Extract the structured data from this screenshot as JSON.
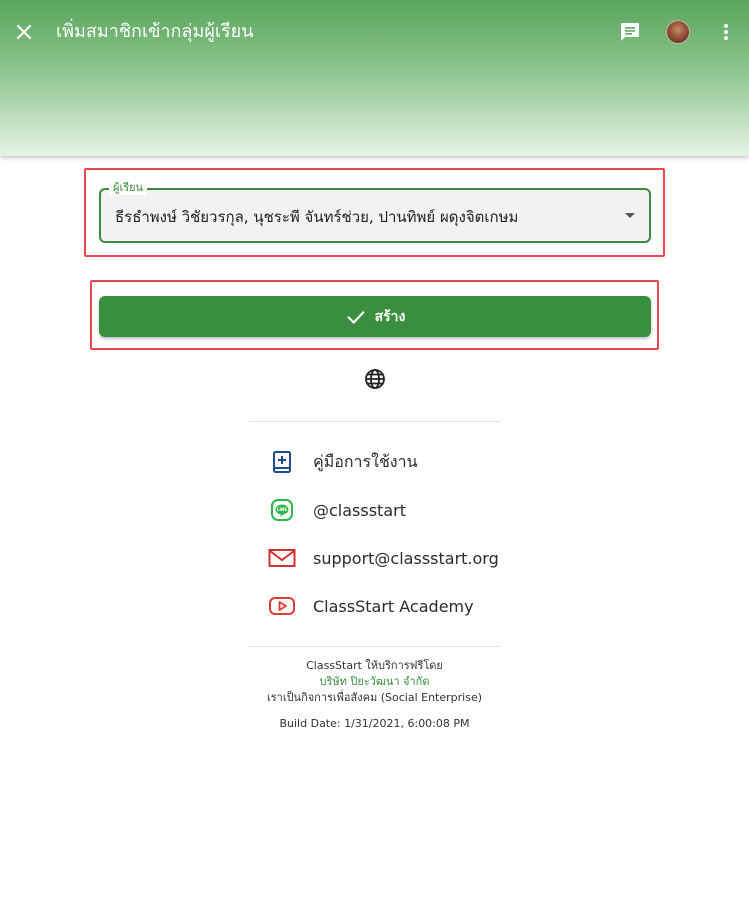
{
  "header": {
    "title": "เพิ่มสมาชิกเข้ากลุ่มผู้เรียน",
    "close_icon": "close-icon",
    "chat_icon": "chat-icon",
    "more_icon": "more-vert-icon"
  },
  "form": {
    "learners_label": "ผู้เรียน",
    "learners_value": "ธีรธำพงษ์ วิชัยวรกุล, นุชระพี จันทร์ช่วย, ปานทิพย์ ผดุงจิตเกษม",
    "create_label": "สร้าง"
  },
  "links": [
    {
      "label": "คู่มือการใช้งาน",
      "icon": "manual-book-icon"
    },
    {
      "label": "@classstart",
      "icon": "line-icon"
    },
    {
      "label": "support@classstart.org",
      "icon": "mail-icon"
    },
    {
      "label": "ClassStart Academy",
      "icon": "youtube-icon"
    }
  ],
  "footer": {
    "line1": "ClassStart ให้บริการฟรีโดย",
    "company": "บริษัท ปิยะวัฒนา จำกัด",
    "line3": "เราเป็นกิจการเพื่อสังคม (Social Enterprise)",
    "build": "Build Date: 1/31/2021, 6:00:08 PM"
  },
  "colors": {
    "primary": "#3a8f3f",
    "highlight": "#e8474b"
  }
}
